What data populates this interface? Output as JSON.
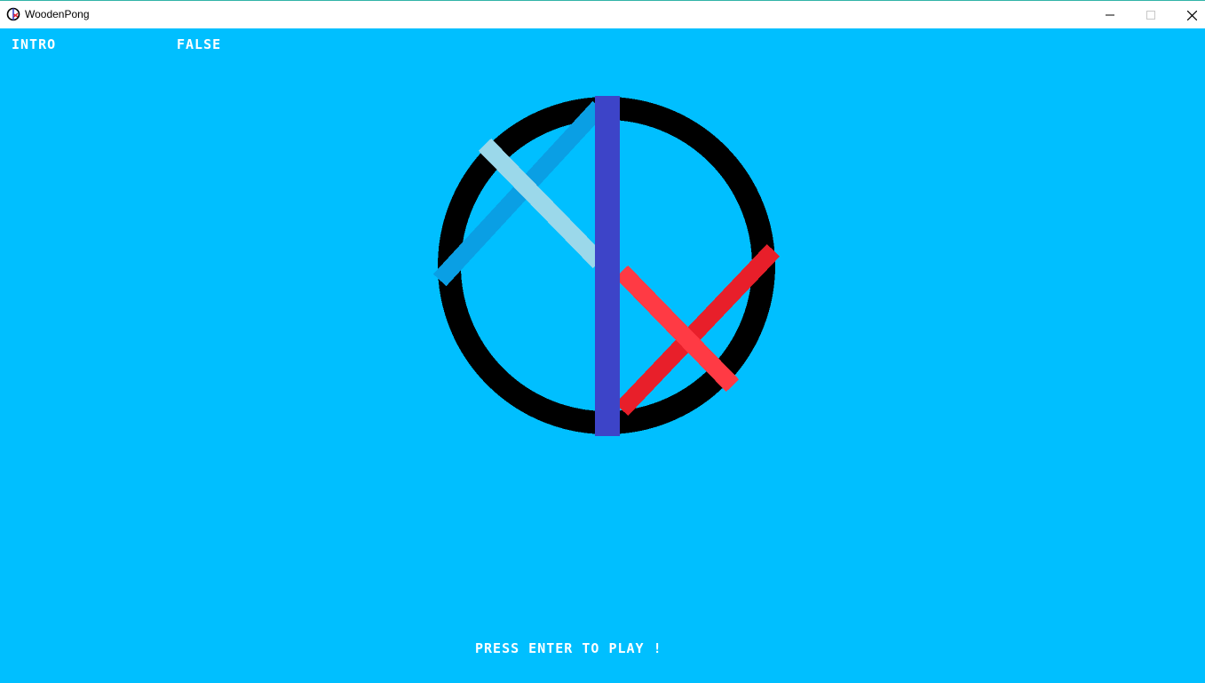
{
  "window": {
    "title": "WoodenPong",
    "icon": "wooden-pong-app-icon",
    "controls": [
      "minimize-icon",
      "maximize-icon",
      "close-icon"
    ]
  },
  "hud": {
    "state_label": "INTRO",
    "state_value": "FALSE",
    "prompt": "PRESS ENTER TO PLAY !"
  },
  "colors": {
    "background": "#00bfff",
    "ring": "#000000",
    "center_bar": "#3d44c8",
    "left_paddle_dark": "#0a9fe4",
    "left_paddle_light": "#9bd8ea",
    "right_paddle_dark": "#e81f2a",
    "right_paddle_light": "#ff3a44",
    "text": "#ffffff"
  }
}
